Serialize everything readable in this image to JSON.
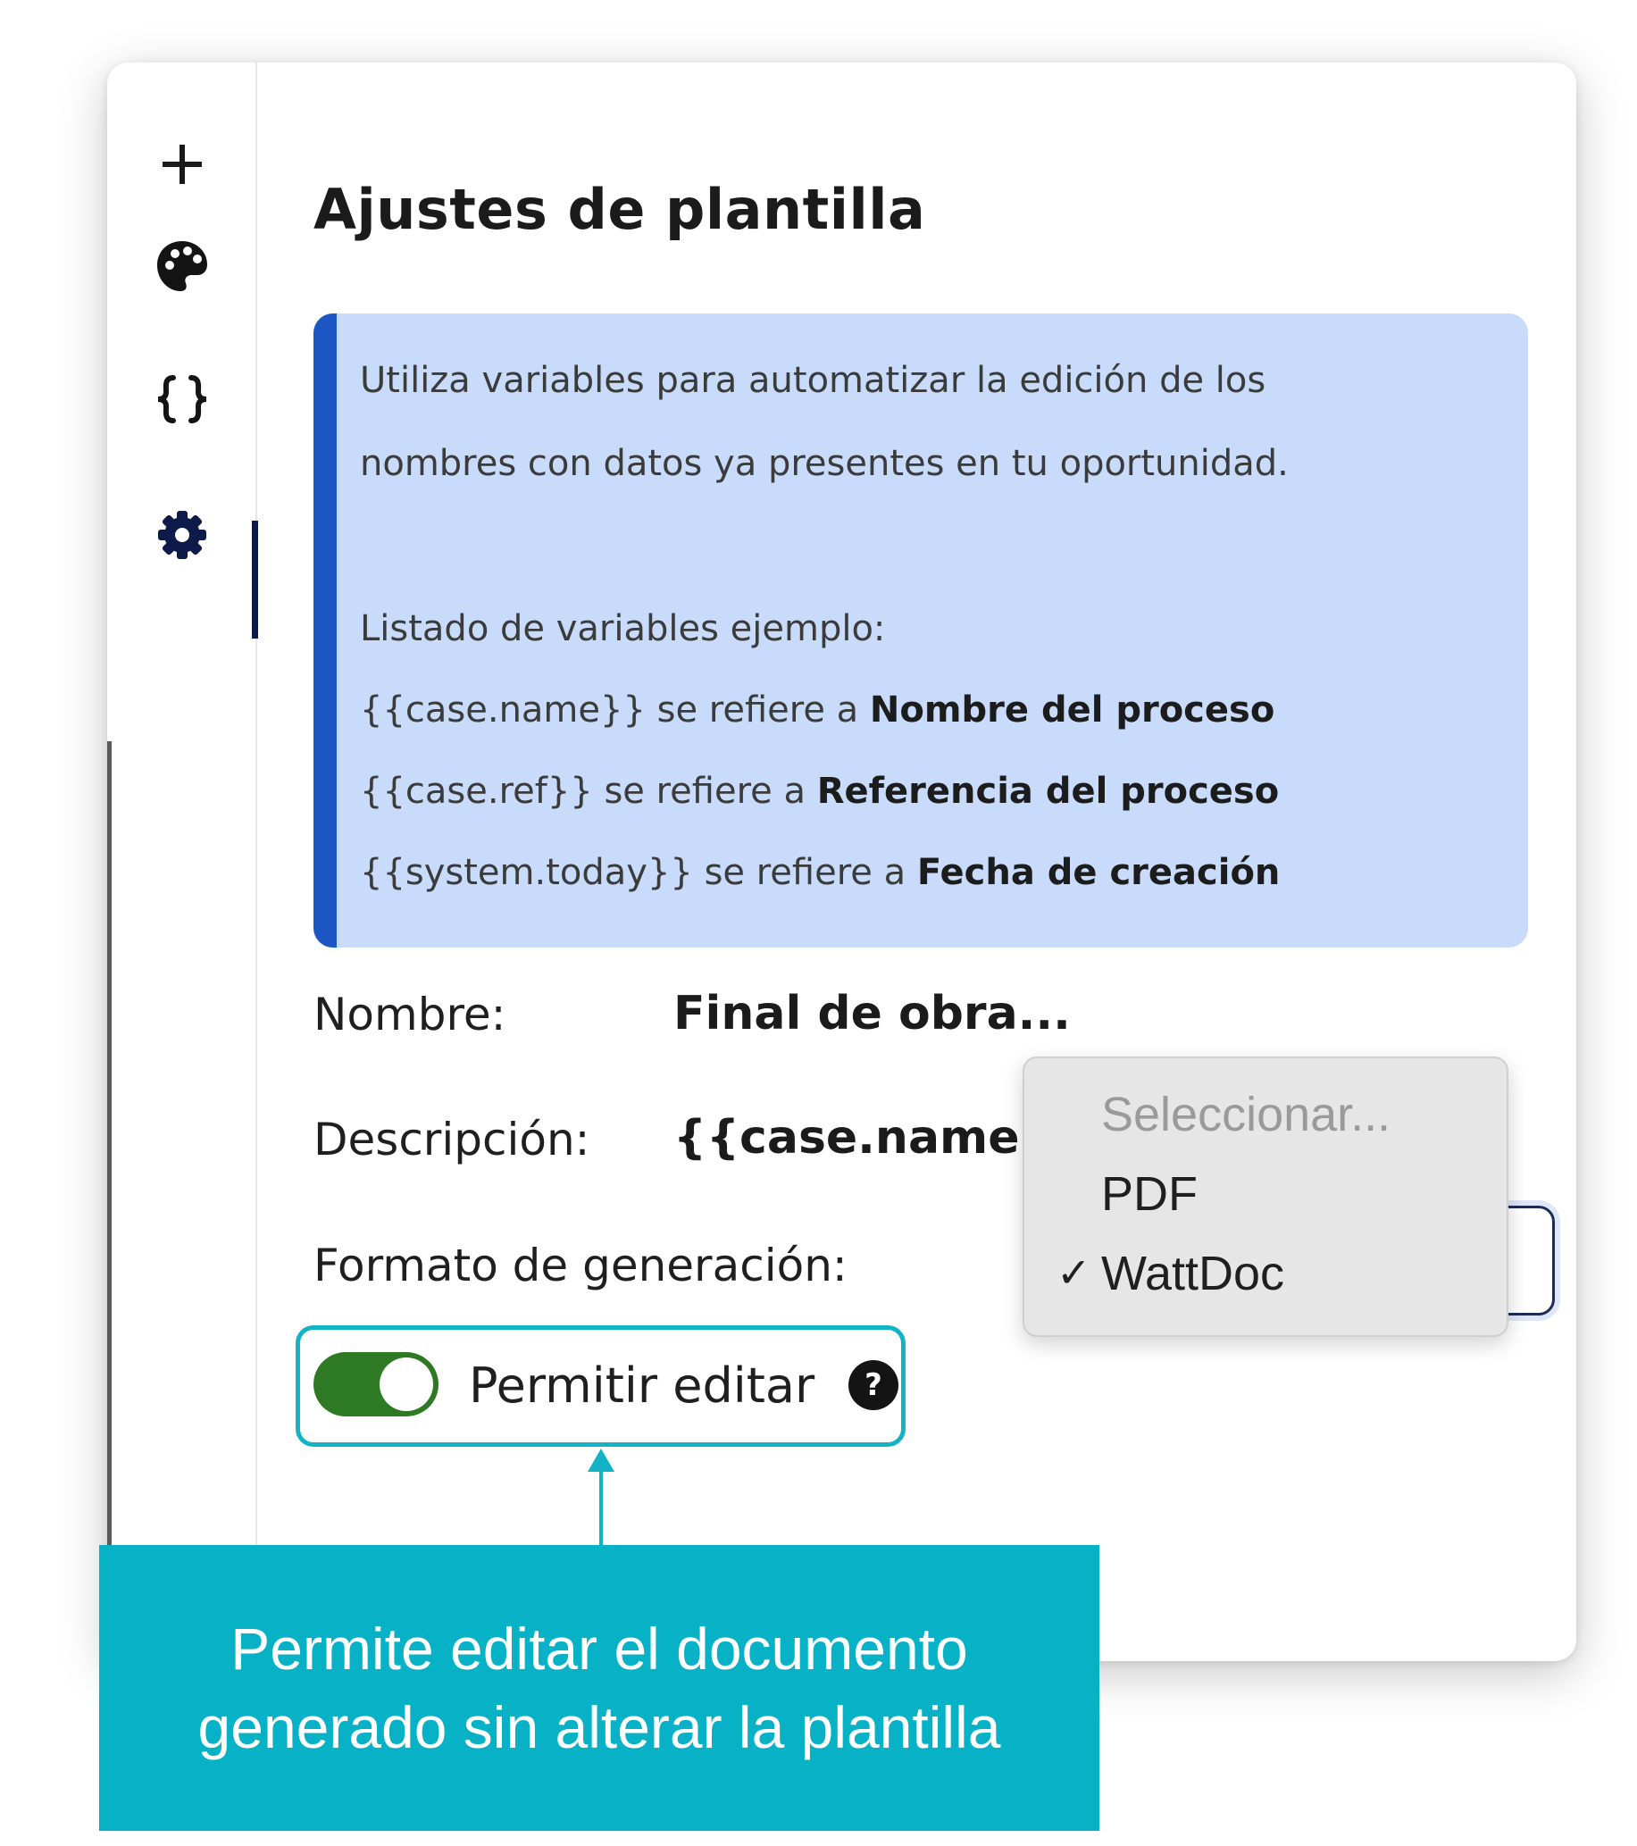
{
  "sidebar": {
    "icons": [
      "plus-icon",
      "palette-icon",
      "braces-icon",
      "gear-icon"
    ],
    "active": "gear-icon"
  },
  "panel": {
    "title": "Ajustes de plantilla"
  },
  "info": {
    "line1": "Utiliza variables para automatizar la edición de los",
    "line2": "nombres con datos ya presentes en tu oportunidad.",
    "list_title": "Listado de variables ejemplo:",
    "variables": [
      {
        "code": "{{case.name}}",
        "connector": " se refiere a ",
        "meaning": "Nombre del proceso"
      },
      {
        "code": "{{case.ref}}",
        "connector": " se refiere a ",
        "meaning": "Referencia del proceso"
      },
      {
        "code": "{{system.today}}",
        "connector": " se refiere a ",
        "meaning": "Fecha de creación"
      }
    ]
  },
  "fields": {
    "name_label": "Nombre:",
    "name_value": "Final de obra...",
    "description_label": "Descripción:",
    "description_value": "{{case.name}}",
    "format_label": "Formato de generación:"
  },
  "format_dropdown": {
    "placeholder": "Seleccionar...",
    "options": [
      "PDF",
      "WattDoc"
    ],
    "selected": "WattDoc",
    "check_mark": "✓"
  },
  "toggle": {
    "label": "Permitir editar",
    "enabled": true,
    "help_symbol": "?"
  },
  "callout": {
    "text": "Permite editar el documento generado sin alterar la plantilla"
  },
  "colors": {
    "accent_blue": "#1b56c2",
    "info_bg": "#c8dbfa",
    "toggle_on": "#2e7a24",
    "callout_teal": "#07b1c6",
    "nav_active": "#0d1a4a"
  }
}
